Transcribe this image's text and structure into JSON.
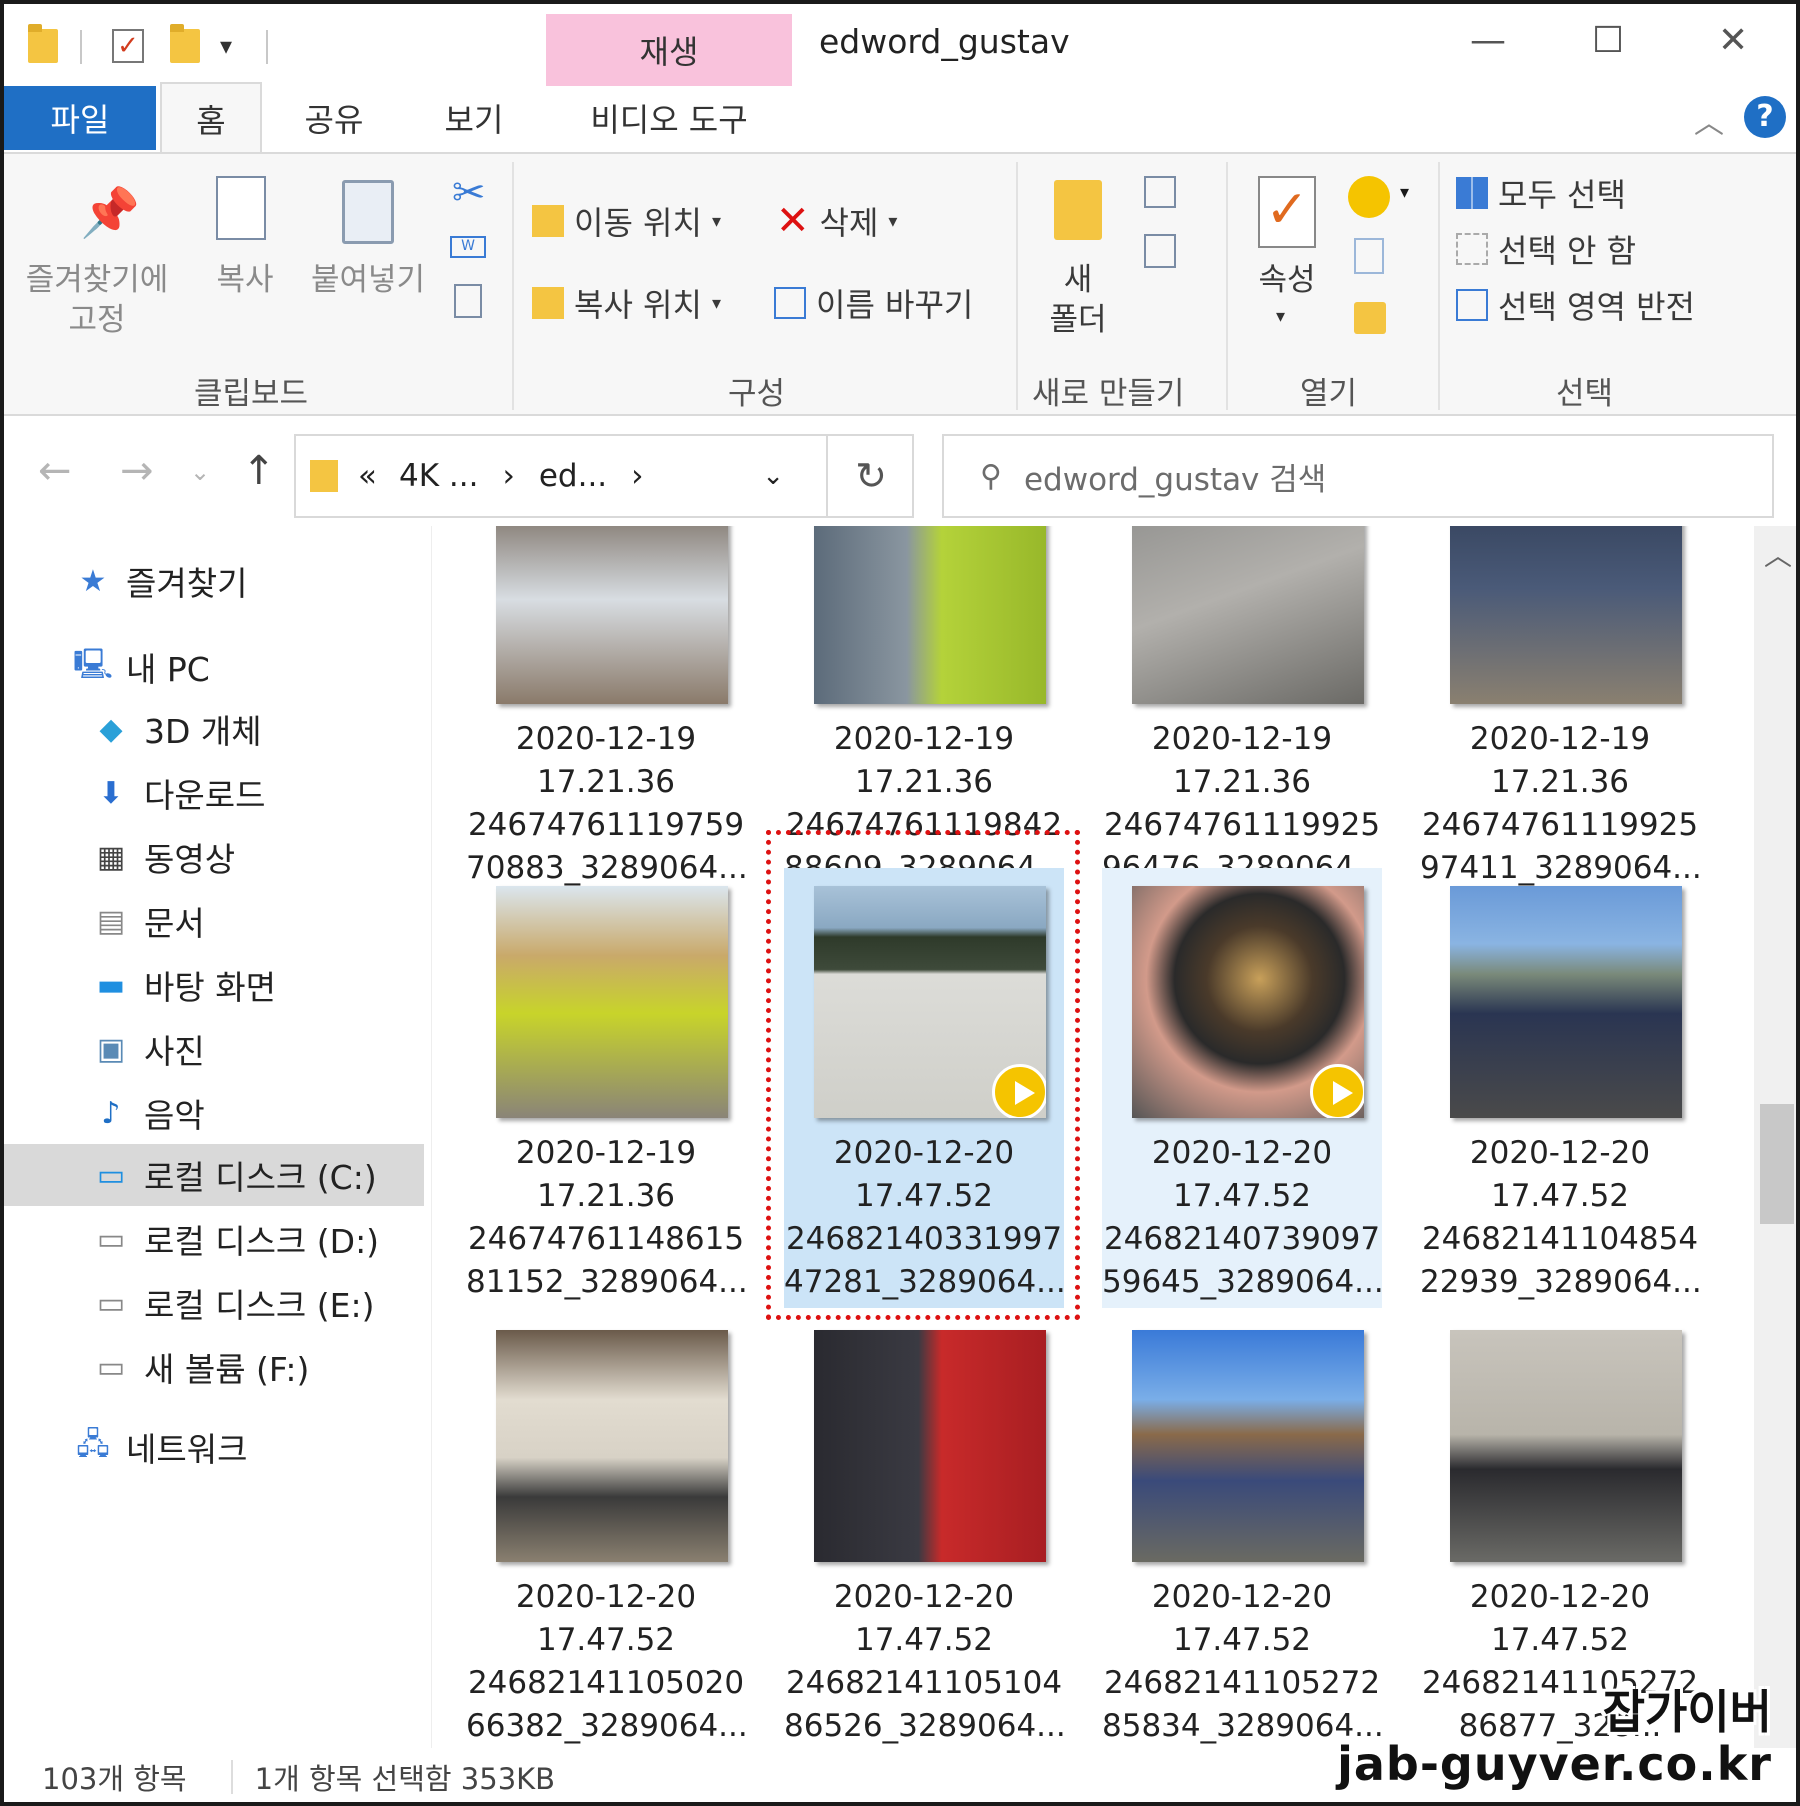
{
  "window": {
    "title": "edword_gustav",
    "context_tab": "재생",
    "minimize": "—",
    "maximize": "☐",
    "close": "✕"
  },
  "tabs": {
    "file": "파일",
    "home": "홈",
    "share": "공유",
    "view": "보기",
    "video_tools": "비디오 도구",
    "help": "?"
  },
  "ribbon": {
    "clipboard": {
      "label": "클립보드",
      "pin": "즐겨찾기에\n고정",
      "copy": "복사",
      "paste": "붙여넣기"
    },
    "organize": {
      "label": "구성",
      "move_to": "이동 위치",
      "delete": "삭제",
      "copy_to": "복사 위치",
      "rename": "이름 바꾸기"
    },
    "new": {
      "label": "새로 만들기",
      "new_folder": "새\n폴더"
    },
    "open": {
      "label": "열기",
      "properties": "속성"
    },
    "select": {
      "label": "선택",
      "select_all": "모두 선택",
      "select_none": "선택 안 함",
      "invert": "선택 영역 반전"
    }
  },
  "address": {
    "overflow": "«",
    "crumb1": "4K ...",
    "crumb2": "ed...",
    "sep": "›",
    "search_placeholder": "edword_gustav 검색"
  },
  "nav": {
    "favorites": "즐겨찾기",
    "this_pc": "내 PC",
    "objects3d": "3D 개체",
    "downloads": "다운로드",
    "videos": "동영상",
    "documents": "문서",
    "desktop": "바탕 화면",
    "pictures": "사진",
    "music": "음악",
    "disk_c": "로컬 디스크 (C:)",
    "disk_d": "로컬 디스크 (D:)",
    "disk_e": "로컬 디스크 (E:)",
    "vol_f": "새 볼륨 (F:)",
    "network": "네트워크"
  },
  "files": [
    {
      "l1": "2020-12-19",
      "l2": "17.21.36",
      "l3": "24674761119759",
      "l4": "70883_3289064...",
      "video": false
    },
    {
      "l1": "2020-12-19",
      "l2": "17.21.36",
      "l3": "24674761119842",
      "l4": "88609_3289064...",
      "video": false
    },
    {
      "l1": "2020-12-19",
      "l2": "17.21.36",
      "l3": "24674761119925",
      "l4": "96476_3289064...",
      "video": false
    },
    {
      "l1": "2020-12-19",
      "l2": "17.21.36",
      "l3": "24674761119925",
      "l4": "97411_3289064...",
      "video": false
    },
    {
      "l1": "2020-12-19",
      "l2": "17.21.36",
      "l3": "24674761148615",
      "l4": "81152_3289064...",
      "video": false
    },
    {
      "l1": "2020-12-20",
      "l2": "17.47.52",
      "l3": "24682140331997",
      "l4": "47281_3289064...",
      "video": true
    },
    {
      "l1": "2020-12-20",
      "l2": "17.47.52",
      "l3": "24682140739097",
      "l4": "59645_3289064...",
      "video": true
    },
    {
      "l1": "2020-12-20",
      "l2": "17.47.52",
      "l3": "24682141104854",
      "l4": "22939_3289064...",
      "video": false
    },
    {
      "l1": "2020-12-20",
      "l2": "17.47.52",
      "l3": "24682141105020",
      "l4": "66382_3289064...",
      "video": false
    },
    {
      "l1": "2020-12-20",
      "l2": "17.47.52",
      "l3": "24682141105104",
      "l4": "86526_3289064...",
      "video": false
    },
    {
      "l1": "2020-12-20",
      "l2": "17.47.52",
      "l3": "24682141105272",
      "l4": "85834_3289064...",
      "video": false
    },
    {
      "l1": "2020-12-20",
      "l2": "17.47.52",
      "l3": "24682141105272",
      "l4": "86877_328...",
      "video": false
    }
  ],
  "status": {
    "count": "103개 항목",
    "selection": "1개 항목 선택함 353KB"
  },
  "watermark": {
    "korean": "잡가이버",
    "domain": "jab-guyver.co.kr"
  },
  "colors": {
    "accent": "#1f6fc5",
    "selection": "#cce4f7",
    "context_tab": "#f9c2dc",
    "highlight_box": "#dd1111"
  }
}
